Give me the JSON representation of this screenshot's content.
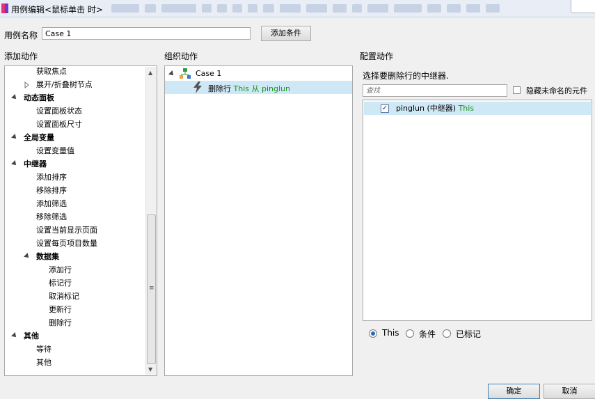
{
  "window": {
    "title": "用例编辑<鼠标单击 时>"
  },
  "case": {
    "label": "用例名称",
    "value": "Case 1",
    "add_condition": "添加条件"
  },
  "sections": {
    "add_action": "添加动作",
    "organize_action": "组织动作",
    "configure_action": "配置动作"
  },
  "action_tree": [
    {
      "label": "获取焦点",
      "level": 2,
      "bold": false,
      "expander": "none"
    },
    {
      "label": "展开/折叠树节点",
      "level": 2,
      "bold": false,
      "expander": "collapsed"
    },
    {
      "label": "动态面板",
      "level": 1,
      "bold": true,
      "expander": "expanded"
    },
    {
      "label": "设置面板状态",
      "level": 2,
      "bold": false,
      "expander": "none"
    },
    {
      "label": "设置面板尺寸",
      "level": 2,
      "bold": false,
      "expander": "none"
    },
    {
      "label": "全局变量",
      "level": 1,
      "bold": true,
      "expander": "expanded"
    },
    {
      "label": "设置变量值",
      "level": 2,
      "bold": false,
      "expander": "none"
    },
    {
      "label": "中继器",
      "level": 1,
      "bold": true,
      "expander": "expanded"
    },
    {
      "label": "添加排序",
      "level": 2,
      "bold": false,
      "expander": "none"
    },
    {
      "label": "移除排序",
      "level": 2,
      "bold": false,
      "expander": "none"
    },
    {
      "label": "添加筛选",
      "level": 2,
      "bold": false,
      "expander": "none"
    },
    {
      "label": "移除筛选",
      "level": 2,
      "bold": false,
      "expander": "none"
    },
    {
      "label": "设置当前显示页面",
      "level": 2,
      "bold": false,
      "expander": "none"
    },
    {
      "label": "设置每页项目数量",
      "level": 2,
      "bold": false,
      "expander": "none"
    },
    {
      "label": "数据集",
      "level": 2,
      "bold": true,
      "expander": "expanded"
    },
    {
      "label": "添加行",
      "level": 3,
      "bold": false,
      "expander": "none"
    },
    {
      "label": "标记行",
      "level": 3,
      "bold": false,
      "expander": "none"
    },
    {
      "label": "取消标记",
      "level": 3,
      "bold": false,
      "expander": "none"
    },
    {
      "label": "更新行",
      "level": 3,
      "bold": false,
      "expander": "none"
    },
    {
      "label": "删除行",
      "level": 3,
      "bold": false,
      "expander": "none"
    },
    {
      "label": "其他",
      "level": 1,
      "bold": true,
      "expander": "expanded"
    },
    {
      "label": "等待",
      "level": 2,
      "bold": false,
      "expander": "none"
    },
    {
      "label": "其他",
      "level": 2,
      "bold": false,
      "expander": "none"
    }
  ],
  "organize": {
    "case_label": "Case 1",
    "action_prefix": "删除行 ",
    "action_green": "This 从 pinglun"
  },
  "configure": {
    "prompt": "选择要删除行的中继器.",
    "search_placeholder": "查找",
    "hide_unnamed": "隐藏未命名的元件",
    "repeater_name": "pinglun (中继器) ",
    "repeater_this": "This",
    "repeater_checked": true,
    "radio_options": [
      "This",
      "条件",
      "已标记"
    ],
    "radio_selected": "This"
  },
  "footer": {
    "ok": "确定",
    "cancel": "取消"
  },
  "colors": {
    "selection": "#cfe8f6",
    "green_text": "#1f8f1f",
    "accent": "#2a68b8"
  }
}
